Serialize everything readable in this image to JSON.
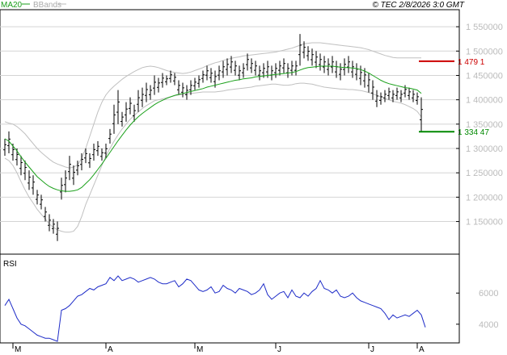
{
  "chart_data": [
    {
      "type": "ohlc",
      "indicator_labels": [
        "MA20",
        "BBands"
      ],
      "copyright": "© TEC 2/8/2026 3:0 GMT",
      "ylim": [
        1083000,
        1585000
      ],
      "y_ticks": [
        1150000,
        1200000,
        1250000,
        1300000,
        1350000,
        1400000,
        1450000,
        1500000,
        1550000
      ],
      "y_tick_labels": [
        "1 150000",
        "1 200000",
        "1 250000",
        "1 300000",
        "1 350000",
        "1 400000",
        "1 450000",
        "1 500000",
        "1 550000"
      ],
      "price_markers": [
        {
          "label": "1 479 1",
          "value": 1479100,
          "color": "#cc0000"
        },
        {
          "label": "1 334 47",
          "value": 1334470,
          "color": "#008800"
        }
      ],
      "ohlc": [
        [
          1320,
          1285
        ],
        [
          1335,
          1290
        ],
        [
          1310,
          1275
        ],
        [
          1300,
          1265
        ],
        [
          1285,
          1245
        ],
        [
          1275,
          1235
        ],
        [
          1255,
          1215
        ],
        [
          1245,
          1205
        ],
        [
          1215,
          1185
        ],
        [
          1205,
          1175
        ],
        [
          1180,
          1150
        ],
        [
          1165,
          1130
        ],
        [
          1155,
          1125
        ],
        [
          1150,
          1110
        ],
        [
          1240,
          1195
        ],
        [
          1255,
          1210
        ],
        [
          1285,
          1235
        ],
        [
          1265,
          1225
        ],
        [
          1275,
          1245
        ],
        [
          1290,
          1255
        ],
        [
          1300,
          1270
        ],
        [
          1290,
          1260
        ],
        [
          1310,
          1275
        ],
        [
          1315,
          1285
        ],
        [
          1300,
          1275
        ],
        [
          1310,
          1280
        ],
        [
          1340,
          1310
        ],
        [
          1390,
          1330
        ],
        [
          1420,
          1350
        ],
        [
          1375,
          1345
        ],
        [
          1395,
          1355
        ],
        [
          1405,
          1370
        ],
        [
          1390,
          1355
        ],
        [
          1420,
          1375
        ],
        [
          1425,
          1385
        ],
        [
          1435,
          1395
        ],
        [
          1430,
          1400
        ],
        [
          1450,
          1410
        ],
        [
          1445,
          1415
        ],
        [
          1455,
          1425
        ],
        [
          1450,
          1430
        ],
        [
          1460,
          1435
        ],
        [
          1455,
          1430
        ],
        [
          1440,
          1410
        ],
        [
          1435,
          1405
        ],
        [
          1430,
          1400
        ],
        [
          1440,
          1410
        ],
        [
          1445,
          1420
        ],
        [
          1450,
          1425
        ],
        [
          1460,
          1435
        ],
        [
          1470,
          1440
        ],
        [
          1465,
          1435
        ],
        [
          1460,
          1425
        ],
        [
          1470,
          1440
        ],
        [
          1480,
          1445
        ],
        [
          1485,
          1450
        ],
        [
          1490,
          1455
        ],
        [
          1480,
          1450
        ],
        [
          1470,
          1440
        ],
        [
          1475,
          1445
        ],
        [
          1495,
          1460
        ],
        [
          1485,
          1455
        ],
        [
          1480,
          1450
        ],
        [
          1470,
          1440
        ],
        [
          1475,
          1445
        ],
        [
          1480,
          1445
        ],
        [
          1470,
          1440
        ],
        [
          1475,
          1445
        ],
        [
          1480,
          1450
        ],
        [
          1485,
          1455
        ],
        [
          1475,
          1445
        ],
        [
          1480,
          1450
        ],
        [
          1480,
          1450
        ],
        [
          1535,
          1470
        ],
        [
          1520,
          1485
        ],
        [
          1510,
          1480
        ],
        [
          1505,
          1470
        ],
        [
          1500,
          1465
        ],
        [
          1495,
          1460
        ],
        [
          1490,
          1455
        ],
        [
          1485,
          1450
        ],
        [
          1490,
          1455
        ],
        [
          1480,
          1445
        ],
        [
          1475,
          1440
        ],
        [
          1485,
          1450
        ],
        [
          1490,
          1455
        ],
        [
          1480,
          1445
        ],
        [
          1475,
          1440
        ],
        [
          1470,
          1430
        ],
        [
          1465,
          1425
        ],
        [
          1455,
          1415
        ],
        [
          1440,
          1400
        ],
        [
          1420,
          1385
        ],
        [
          1415,
          1390
        ],
        [
          1420,
          1395
        ],
        [
          1425,
          1400
        ],
        [
          1420,
          1395
        ],
        [
          1425,
          1400
        ],
        [
          1420,
          1395
        ],
        [
          1430,
          1405
        ],
        [
          1425,
          1400
        ],
        [
          1420,
          1395
        ],
        [
          1415,
          1390
        ],
        [
          1405,
          1334
        ]
      ],
      "ohlc_units": "thousands",
      "ma20": [
        1320,
        1315,
        1305,
        1295,
        1283,
        1272,
        1262,
        1252,
        1242,
        1235,
        1228,
        1222,
        1218,
        1215,
        1213,
        1212,
        1212,
        1213,
        1215,
        1220,
        1228,
        1236,
        1246,
        1257,
        1268,
        1280,
        1292,
        1304,
        1316,
        1327,
        1338,
        1348,
        1357,
        1365,
        1372,
        1378,
        1384,
        1390,
        1395,
        1399,
        1403,
        1406,
        1409,
        1411,
        1413,
        1415,
        1417,
        1419,
        1421,
        1423,
        1426,
        1428,
        1430,
        1432,
        1434,
        1436,
        1438,
        1440,
        1441,
        1443,
        1444,
        1445,
        1447,
        1448,
        1449,
        1450,
        1451,
        1452,
        1453,
        1454,
        1455,
        1456,
        1458,
        1461,
        1464,
        1466,
        1467,
        1468,
        1469,
        1469,
        1469,
        1469,
        1468,
        1467,
        1466,
        1466,
        1465,
        1464,
        1462,
        1459,
        1455,
        1450,
        1445,
        1440,
        1436,
        1433,
        1431,
        1429,
        1427,
        1425,
        1424,
        1422,
        1420,
        1413
      ],
      "bb_upper": [
        1355,
        1352,
        1350,
        1345,
        1338,
        1330,
        1320,
        1310,
        1300,
        1292,
        1285,
        1278,
        1272,
        1268,
        1265,
        1262,
        1260,
        1262,
        1266,
        1280,
        1300,
        1325,
        1350,
        1375,
        1395,
        1410,
        1420,
        1428,
        1435,
        1442,
        1448,
        1453,
        1458,
        1462,
        1466,
        1468,
        1469,
        1468,
        1466,
        1463,
        1460,
        1458,
        1456,
        1455,
        1454,
        1455,
        1457,
        1460,
        1463,
        1466,
        1470,
        1473,
        1476,
        1478,
        1481,
        1483,
        1485,
        1487,
        1488,
        1490,
        1491,
        1492,
        1493,
        1494,
        1495,
        1496,
        1497,
        1498,
        1500,
        1502,
        1504,
        1506,
        1509,
        1512,
        1515,
        1516,
        1517,
        1517,
        1517,
        1516,
        1515,
        1514,
        1513,
        1512,
        1511,
        1510,
        1509,
        1508,
        1507,
        1505,
        1503,
        1500,
        1497,
        1494,
        1491,
        1489,
        1487,
        1486,
        1486,
        1486,
        1486,
        1486,
        1486,
        1486
      ],
      "bb_lower": [
        1280,
        1275,
        1265,
        1250,
        1232,
        1215,
        1200,
        1188,
        1175,
        1165,
        1155,
        1145,
        1138,
        1133,
        1130,
        1128,
        1128,
        1130,
        1140,
        1160,
        1185,
        1205,
        1225,
        1245,
        1265,
        1285,
        1300,
        1315,
        1328,
        1340,
        1350,
        1360,
        1368,
        1375,
        1382,
        1388,
        1393,
        1398,
        1400,
        1402,
        1404,
        1406,
        1408,
        1410,
        1411,
        1412,
        1413,
        1414,
        1415,
        1416,
        1416,
        1416,
        1416,
        1417,
        1418,
        1420,
        1421,
        1422,
        1423,
        1424,
        1425,
        1426,
        1428,
        1429,
        1430,
        1431,
        1432,
        1432,
        1431,
        1430,
        1430,
        1431,
        1433,
        1434,
        1434,
        1433,
        1432,
        1430,
        1428,
        1426,
        1425,
        1424,
        1423,
        1422,
        1422,
        1421,
        1421,
        1420,
        1419,
        1417,
        1415,
        1412,
        1409,
        1406,
        1403,
        1400,
        1397,
        1395,
        1393,
        1390,
        1386,
        1382,
        1376,
        1365
      ],
      "x_ticks": [
        {
          "label": "M",
          "index": 2
        },
        {
          "label": "A",
          "index": 25
        },
        {
          "label": "M",
          "index": 47
        },
        {
          "label": "J",
          "index": 67
        },
        {
          "label": "J",
          "index": 90
        },
        {
          "label": "A",
          "index": 102
        }
      ]
    },
    {
      "type": "line",
      "title": "RSI",
      "ylim": [
        28,
        85
      ],
      "y_ticks": [
        40,
        60
      ],
      "y_tick_labels": [
        "4000",
        "6000"
      ],
      "values": [
        52,
        56,
        50,
        44,
        40,
        39,
        37,
        35,
        33,
        32,
        31,
        31,
        30,
        29,
        49,
        50,
        52,
        55,
        58,
        59,
        61,
        63,
        62,
        64,
        65,
        66,
        70,
        68,
        71,
        68,
        69,
        70,
        69,
        67,
        68,
        69,
        70,
        69,
        67,
        66,
        66,
        67,
        68,
        64,
        66,
        69,
        68,
        65,
        62,
        61,
        62,
        64,
        60,
        61,
        65,
        63,
        62,
        60,
        63,
        62,
        61,
        59,
        60,
        62,
        66,
        59,
        56,
        58,
        60,
        61,
        57,
        62,
        58,
        57,
        60,
        58,
        61,
        63,
        68,
        63,
        62,
        60,
        62,
        58,
        57,
        58,
        60,
        57,
        55,
        54,
        53,
        52,
        51,
        50,
        47,
        43,
        46,
        44,
        45,
        46,
        45,
        47,
        49,
        46,
        38
      ]
    }
  ]
}
